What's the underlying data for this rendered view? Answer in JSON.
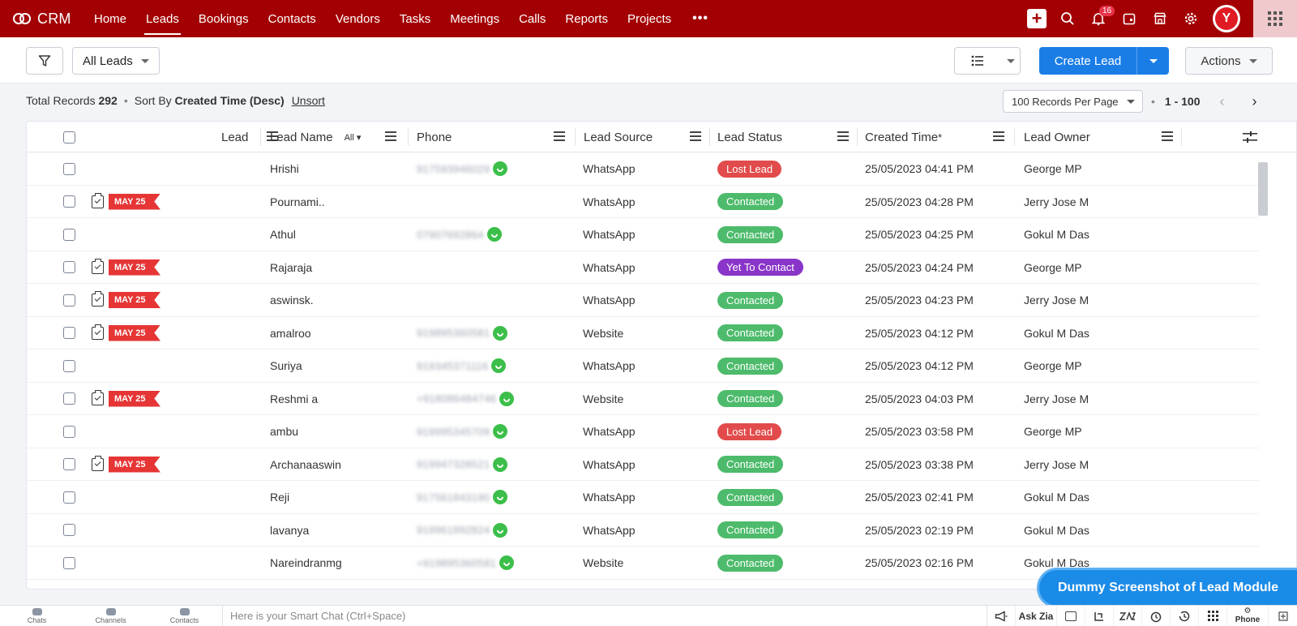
{
  "nav": {
    "brand": "CRM",
    "items": [
      {
        "label": "Home",
        "active": false
      },
      {
        "label": "Leads",
        "active": true
      },
      {
        "label": "Bookings",
        "active": false
      },
      {
        "label": "Contacts",
        "active": false
      },
      {
        "label": "Vendors",
        "active": false
      },
      {
        "label": "Tasks",
        "active": false
      },
      {
        "label": "Meetings",
        "active": false
      },
      {
        "label": "Calls",
        "active": false
      },
      {
        "label": "Reports",
        "active": false
      },
      {
        "label": "Projects",
        "active": false
      }
    ],
    "more": "•••",
    "notification_count": "16",
    "avatar_letter": "Y",
    "icons": [
      "plus-icon",
      "search-icon",
      "bell-icon",
      "calendar-icon",
      "store-icon",
      "gear-icon",
      "avatar",
      "apps-grid-icon"
    ]
  },
  "toolbar": {
    "view_filter": "All Leads",
    "create_label": "Create Lead",
    "actions_label": "Actions"
  },
  "info": {
    "total_label": "Total Records",
    "total_count": "292",
    "sort_label": "Sort By",
    "sort_value": "Created Time (Desc)",
    "unsort": "Unsort",
    "per_page": "100 Records Per Page",
    "range": "1 - 100"
  },
  "table": {
    "columns": {
      "lead": "Lead",
      "lead_name": "Lead Name",
      "lead_name_filter": "All",
      "phone": "Phone",
      "lead_source": "Lead Source",
      "lead_status": "Lead Status",
      "created_time": "Created Time",
      "created_time_mark": "*",
      "lead_owner": "Lead Owner"
    },
    "rows": [
      {
        "task": false,
        "tag": "",
        "name": "Hrishi",
        "phone": "917593946029",
        "wa": true,
        "source": "WhatsApp",
        "status": "Lost Lead",
        "created": "25/05/2023 04:41 PM",
        "owner": "George MP"
      },
      {
        "task": true,
        "tag": "MAY 25",
        "name": "Pournami..",
        "phone": "",
        "wa": false,
        "source": "WhatsApp",
        "status": "Contacted",
        "created": "25/05/2023 04:28 PM",
        "owner": "Jerry Jose M"
      },
      {
        "task": false,
        "tag": "",
        "name": "Athul",
        "phone": "07907692864",
        "wa": true,
        "source": "WhatsApp",
        "status": "Contacted",
        "created": "25/05/2023 04:25 PM",
        "owner": "Gokul M Das"
      },
      {
        "task": true,
        "tag": "MAY 25",
        "name": "Rajaraja",
        "phone": "",
        "wa": false,
        "source": "WhatsApp",
        "status": "Yet To Contact",
        "created": "25/05/2023 04:24 PM",
        "owner": "George MP"
      },
      {
        "task": true,
        "tag": "MAY 25",
        "name": "aswinsk.",
        "phone": "",
        "wa": false,
        "source": "WhatsApp",
        "status": "Contacted",
        "created": "25/05/2023 04:23 PM",
        "owner": "Jerry Jose M"
      },
      {
        "task": true,
        "tag": "MAY 25",
        "name": "amalroo",
        "phone": "919895360581",
        "wa": true,
        "source": "Website",
        "status": "Contacted",
        "created": "25/05/2023 04:12 PM",
        "owner": "Gokul M Das"
      },
      {
        "task": false,
        "tag": "",
        "name": "Suriya",
        "phone": "919345371116",
        "wa": true,
        "source": "WhatsApp",
        "status": "Contacted",
        "created": "25/05/2023 04:12 PM",
        "owner": "George MP"
      },
      {
        "task": true,
        "tag": "MAY 25",
        "name": "Reshmi a",
        "phone": "+918086484746",
        "wa": true,
        "source": "Website",
        "status": "Contacted",
        "created": "25/05/2023 04:03 PM",
        "owner": "Jerry Jose M"
      },
      {
        "task": false,
        "tag": "",
        "name": "ambu",
        "phone": "919995345709",
        "wa": true,
        "source": "WhatsApp",
        "status": "Lost Lead",
        "created": "25/05/2023 03:58 PM",
        "owner": "George MP"
      },
      {
        "task": true,
        "tag": "MAY 25",
        "name": "Archanaaswin",
        "phone": "919947328521",
        "wa": true,
        "source": "WhatsApp",
        "status": "Contacted",
        "created": "25/05/2023 03:38 PM",
        "owner": "Jerry Jose M"
      },
      {
        "task": false,
        "tag": "",
        "name": "Reji",
        "phone": "917561843190",
        "wa": true,
        "source": "WhatsApp",
        "status": "Contacted",
        "created": "25/05/2023 02:41 PM",
        "owner": "Gokul M Das"
      },
      {
        "task": false,
        "tag": "",
        "name": "lavanya",
        "phone": "919961892824",
        "wa": true,
        "source": "WhatsApp",
        "status": "Contacted",
        "created": "25/05/2023 02:19 PM",
        "owner": "Gokul M Das"
      },
      {
        "task": false,
        "tag": "",
        "name": "Nareindranmg",
        "phone": "+919895360581",
        "wa": true,
        "source": "Website",
        "status": "Contacted",
        "created": "25/05/2023 02:16 PM",
        "owner": "Gokul M Das"
      }
    ]
  },
  "status_colors": {
    "Lost Lead": "#e24b4b",
    "Contacted": "#4dbb6b",
    "Yet To Contact": "#8a35c9"
  },
  "banner": "Dummy Screenshot of Lead Module",
  "bottom": {
    "chats": "Chats",
    "channels": "Channels",
    "contacts": "Contacts",
    "smartchat_placeholder": "Here is your Smart Chat (Ctrl+Space)",
    "ask_zia": "Ask Zia",
    "phone": "Phone"
  }
}
